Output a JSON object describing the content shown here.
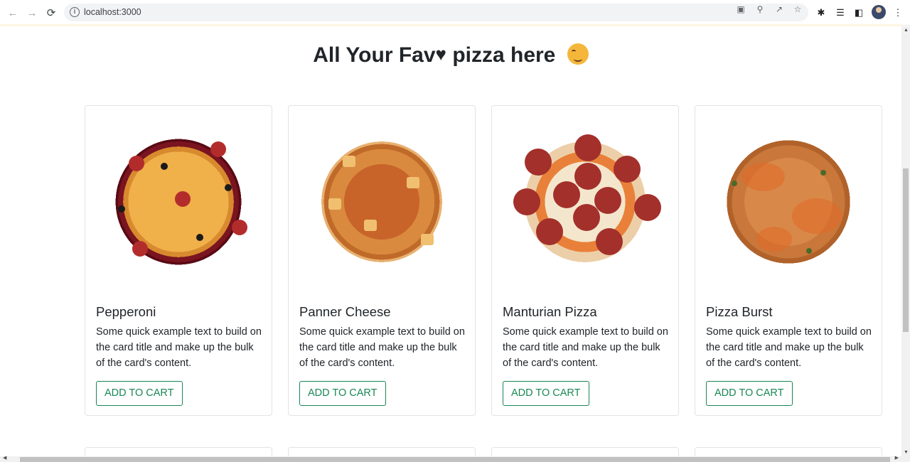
{
  "browser": {
    "url": "localhost:3000",
    "back_icon": "arrow-left-icon",
    "forward_icon": "arrow-right-icon",
    "reload_icon": "reload-icon"
  },
  "page": {
    "title_prefix": "All Your Fav",
    "title_heart": "♥",
    "title_suffix": "pizza here"
  },
  "cards": [
    {
      "name": "Pepperoni",
      "description": "Some quick example text to build on the card title and make up the bulk of the card's content.",
      "button": "ADD TO CART"
    },
    {
      "name": "Panner Cheese",
      "description": "Some quick example text to build on the card title and make up the bulk of the card's content.",
      "button": "ADD TO CART"
    },
    {
      "name": "Manturian Pizza",
      "description": "Some quick example text to build on the card title and make up the bulk of the card's content.",
      "button": "ADD TO CART"
    },
    {
      "name": "Pizza Burst",
      "description": "Some quick example text to build on the card title and make up the bulk of the card's content.",
      "button": "ADD TO CART"
    }
  ],
  "colors": {
    "button_accent": "#198754",
    "title_text": "#212529"
  }
}
